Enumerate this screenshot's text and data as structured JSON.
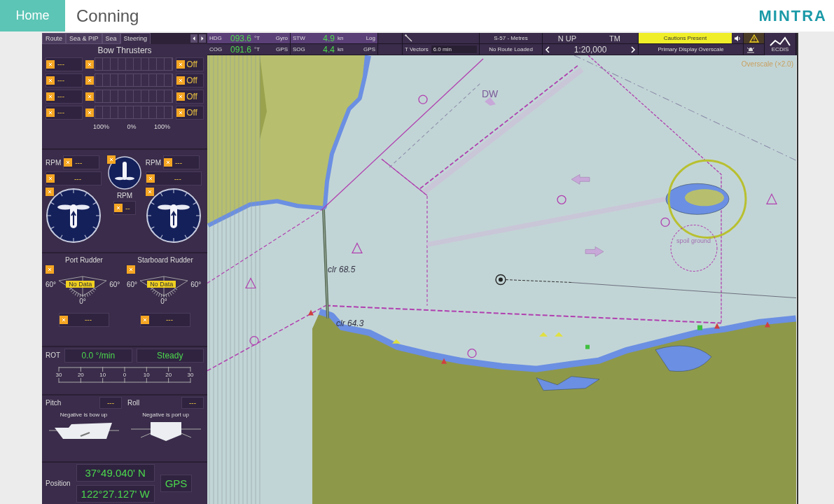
{
  "header": {
    "home": "Home",
    "title": "Conning",
    "logo": "MINTRA"
  },
  "tabs": [
    {
      "label": "Route",
      "selected": false
    },
    {
      "label": "Sea & PIP",
      "selected": false
    },
    {
      "label": "Sea",
      "selected": false
    },
    {
      "label": "Steering",
      "selected": true
    }
  ],
  "bow_thrusters": {
    "title": "Bow Thrusters",
    "rows": [
      {
        "value": "---",
        "state": "Off"
      },
      {
        "value": "---",
        "state": "Off"
      },
      {
        "value": "---",
        "state": "Off"
      },
      {
        "value": "---",
        "state": "Off"
      }
    ],
    "scale": [
      "100%",
      "0%",
      "100%"
    ]
  },
  "propulsion": {
    "port": {
      "rpm_label": "RPM",
      "rpm": "---",
      "pitch": "---"
    },
    "center": {
      "rpm_label": "RPM",
      "rpm": "--"
    },
    "starboard": {
      "rpm_label": "RPM",
      "rpm": "---",
      "pitch": "---"
    }
  },
  "rudders": [
    {
      "label": "Port Rudder",
      "min": "60°",
      "max": "60°",
      "zero": "0°",
      "status": "No Data",
      "value": "---"
    },
    {
      "label": "Starboard Rudder",
      "min": "60°",
      "max": "60°",
      "zero": "0°",
      "status": "No Data",
      "value": "---"
    }
  ],
  "rot": {
    "label": "ROT",
    "rate": "0.0 °/min",
    "status": "Steady",
    "ticks": [
      "30",
      "20",
      "10",
      "0",
      "10",
      "20",
      "30"
    ]
  },
  "attitude": [
    {
      "kind": "pitch",
      "label": "Pitch",
      "value": "---",
      "note": "Negative is bow up"
    },
    {
      "kind": "roll",
      "label": "Roll",
      "value": "---",
      "note": "Negative is port up"
    }
  ],
  "position": {
    "label": "Position",
    "lat": "37°49.040' N",
    "lon": "122°27.127' W",
    "source": "GPS"
  },
  "nav": [
    {
      "label": "HDG",
      "value": "093.6",
      "unit": "°T",
      "source": "Gyro"
    },
    {
      "label": "COG",
      "value": "091.6",
      "unit": "°T",
      "source": "GPS"
    },
    {
      "label": "STW",
      "value": "4.9",
      "unit": "kn",
      "source": "Log"
    },
    {
      "label": "SOG",
      "value": "4.4",
      "unit": "kn",
      "source": "GPS"
    }
  ],
  "vectors": {
    "label": "T Vectors",
    "value": "6.0 min"
  },
  "chart_format": "S-57 - Metres",
  "route": "No Route Loaded",
  "orientation": "N UP",
  "motion": "TM",
  "scale": "1:20,000",
  "caution": "Cautions Present",
  "display_status": "Primary Display Overscale",
  "ecdis": "ECDIS",
  "chart": {
    "overscale": "Overscale (×2.0)",
    "clearances": [
      "clr 68.5",
      "clr 64.3"
    ],
    "area_label": "spoil ground",
    "lane_label": "DW"
  }
}
